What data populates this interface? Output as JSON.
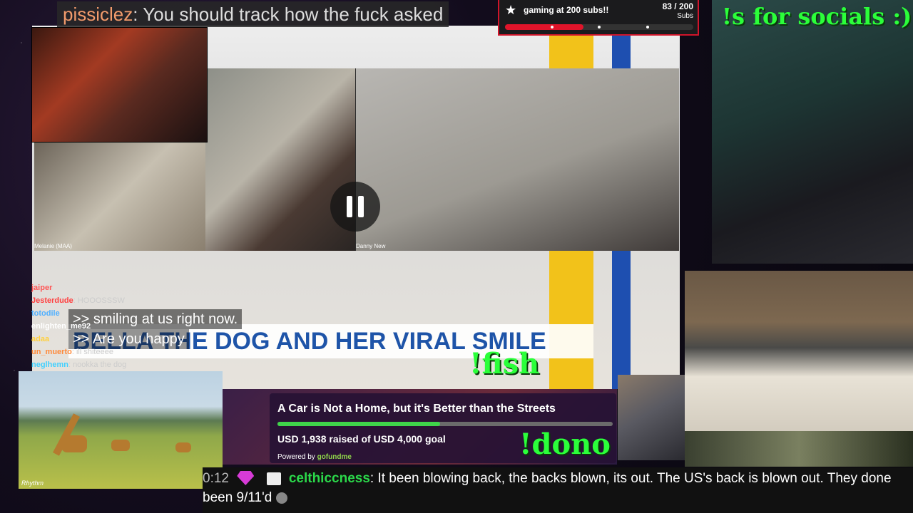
{
  "top_chat": {
    "user": "pissiclez",
    "message": "You should track how the fuck asked"
  },
  "sub_goal": {
    "title": "gaming at 200 subs!!",
    "count": "83 / 200",
    "unit": "Subs",
    "progress": 0.415,
    "accent": "#d0142a"
  },
  "video": {
    "left_name": "Melanie (MAA)",
    "right_name": "Danny New",
    "headline": "BELLA THE DOG AND HER VIRAL SMILE",
    "captions": [
      ">> smiling at us right now.",
      ">> Are you happy"
    ],
    "playback_state": "paused"
  },
  "mini_chat": [
    {
      "user": "jaiper",
      "message": "",
      "color": "#ff5555"
    },
    {
      "user": "Jesterdude",
      "message": "HOOOSSSW",
      "color": "#ff4040"
    },
    {
      "user": "totodile",
      "message": "",
      "color": "#50b0ff"
    },
    {
      "user": "enlighten_me92",
      "message": "",
      "color": "#ffffff"
    },
    {
      "user": "adaa",
      "message": "",
      "color": "#ffd040"
    },
    {
      "user": "un_muerto",
      "message": "ill shiteeee",
      "color": "#ff8a3a"
    },
    {
      "user": "neglhemn",
      "message": "nookka the dog",
      "color": "#40d0ff"
    }
  ],
  "overlays": {
    "socials": "!s for socials :)",
    "fish": "!fish",
    "dono": "!dono"
  },
  "donation": {
    "title": "A Car is Not a Home, but it's Better than the Streets",
    "raised": "USD 1,938 raised of USD 4,000 goal",
    "powered_by": "Powered by",
    "platform": "gofundme",
    "progress": 0.4845
  },
  "giraffe_logo": "Rhythm",
  "bottom_chat": {
    "time": "0:12",
    "user": "celthiccness",
    "message": "It been blowing back, the backs blown, its out. The US's back is blown out. They done been 9/11'd"
  }
}
